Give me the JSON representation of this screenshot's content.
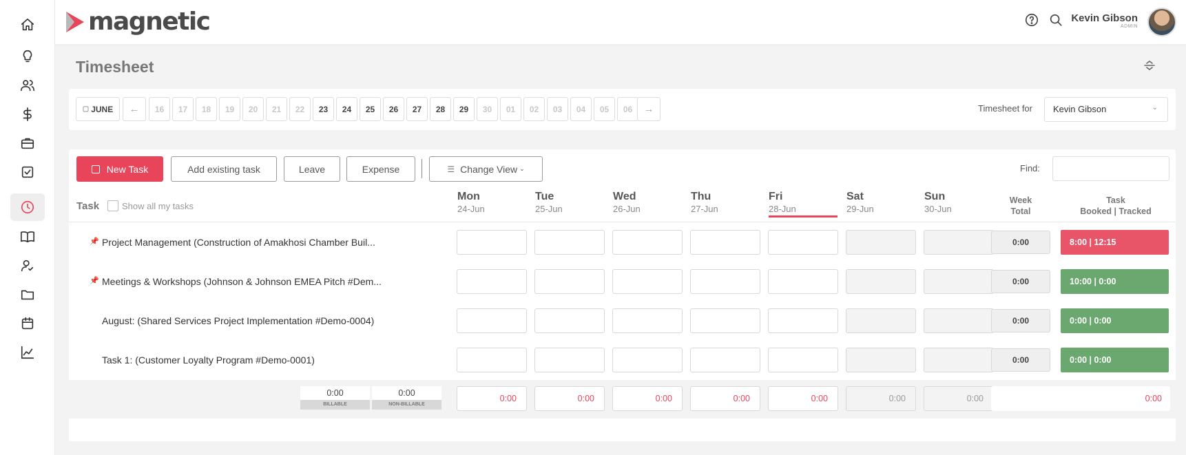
{
  "app": {
    "logo_text": "magnetic",
    "brand_color": "#e8445a"
  },
  "sidebar": {
    "items": [
      {
        "icon": "home-icon",
        "active": false
      },
      {
        "icon": "lightbulb-icon",
        "active": false
      },
      {
        "icon": "users-icon",
        "active": false
      },
      {
        "icon": "dollar-icon",
        "active": false
      },
      {
        "icon": "briefcase-icon",
        "active": false
      },
      {
        "icon": "checkbox-icon",
        "active": false
      },
      {
        "icon": "clock-icon",
        "active": true
      },
      {
        "icon": "book-icon",
        "active": false
      },
      {
        "icon": "user-check-icon",
        "active": false
      },
      {
        "icon": "folder-icon",
        "active": false
      },
      {
        "icon": "calendar-icon",
        "active": false
      },
      {
        "icon": "chart-icon",
        "active": false
      }
    ]
  },
  "header": {
    "user_name": "Kevin Gibson",
    "user_role": "ADMIN"
  },
  "page": {
    "title": "Timesheet"
  },
  "date_strip": {
    "month": "JUNE",
    "prev_arrow": "←",
    "next_arrow": "→",
    "dates": [
      "16",
      "17",
      "18",
      "19",
      "20",
      "21",
      "22",
      "23",
      "24",
      "25",
      "26",
      "27",
      "28",
      "29",
      "30",
      "01",
      "02",
      "03",
      "04",
      "05",
      "06"
    ],
    "emphasized": [
      "23",
      "24",
      "25",
      "26",
      "27",
      "28",
      "29"
    ],
    "timesheet_for_label": "Timesheet for",
    "timesheet_for_value": "Kevin Gibson"
  },
  "toolbar": {
    "new_task": "New Task",
    "add_existing": "Add existing task",
    "leave": "Leave",
    "expense": "Expense",
    "change_view": "Change View",
    "find_label": "Find:"
  },
  "table": {
    "task_header": "Task",
    "show_all_label": "Show all my tasks",
    "days": [
      {
        "name": "Mon",
        "date": "24-Jun"
      },
      {
        "name": "Tue",
        "date": "25-Jun"
      },
      {
        "name": "Wed",
        "date": "26-Jun"
      },
      {
        "name": "Thu",
        "date": "27-Jun"
      },
      {
        "name": "Fri",
        "date": "28-Jun",
        "today": true
      },
      {
        "name": "Sat",
        "date": "29-Jun"
      },
      {
        "name": "Sun",
        "date": "30-Jun"
      }
    ],
    "week_total_header_1": "Week",
    "week_total_header_2": "Total",
    "task_booked_header_1": "Task",
    "task_booked_header_2": "Booked | Tracked",
    "rows": [
      {
        "task": "Project Management (Construction of Amakhosi Chamber Buil...",
        "pinned": true,
        "week_total": "0:00",
        "booked_tracked": "8:00 | 12:15",
        "status_color": "#e85468"
      },
      {
        "task": "Meetings & Workshops (Johnson & Johnson EMEA Pitch #Dem...",
        "pinned": true,
        "week_total": "0:00",
        "booked_tracked": "10:00 | 0:00",
        "status_color": "#6aa86f"
      },
      {
        "task": "August: (Shared Services Project Implementation #Demo-0004)",
        "pinned": false,
        "week_total": "0:00",
        "booked_tracked": "0:00 | 0:00",
        "status_color": "#6aa86f"
      },
      {
        "task": "Task 1: (Customer Loyalty Program #Demo-0001)",
        "pinned": false,
        "week_total": "0:00",
        "booked_tracked": "0:00 | 0:00",
        "status_color": "#6aa86f"
      }
    ],
    "totals": {
      "billable_value": "0:00",
      "billable_label": "BILLABLE",
      "non_billable_value": "0:00",
      "non_billable_label": "NON-BILLABLE",
      "day_totals": [
        "0:00",
        "0:00",
        "0:00",
        "0:00",
        "0:00",
        "0:00",
        "0:00"
      ],
      "grand_total": "0:00"
    }
  }
}
